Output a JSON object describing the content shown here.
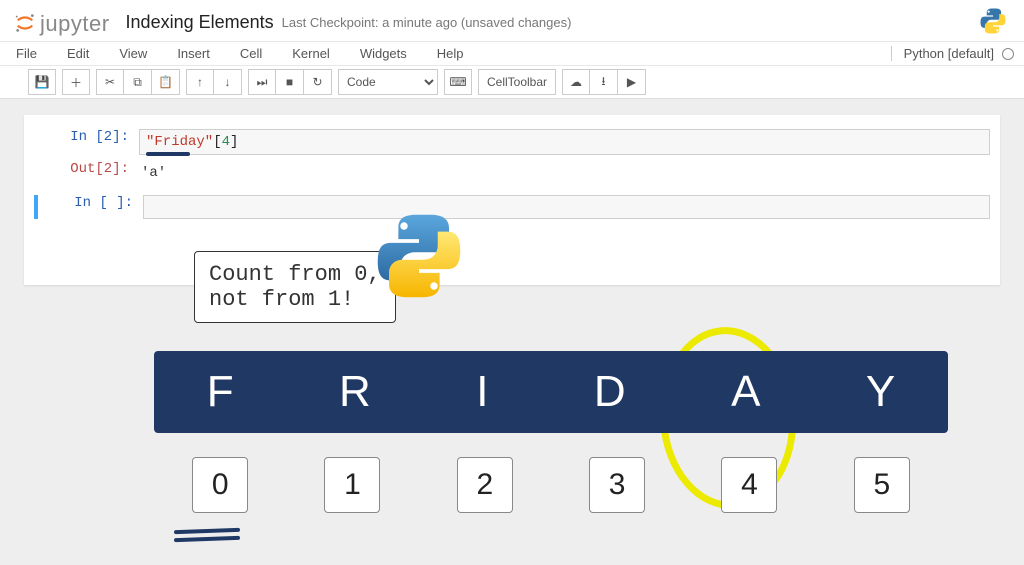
{
  "header": {
    "logo_text": "jupyter",
    "notebook_title": "Indexing Elements",
    "checkpoint": "Last Checkpoint: a minute ago (unsaved changes)"
  },
  "menubar": {
    "items": [
      "File",
      "Edit",
      "View",
      "Insert",
      "Cell",
      "Kernel",
      "Widgets",
      "Help"
    ],
    "kernel_label": "Python [default]"
  },
  "toolbar": {
    "celltype": "Code",
    "cell_toolbar_label": "CellToolbar"
  },
  "cells": {
    "in2_prompt": "In [2]:",
    "in2_code_string": "\"Friday\"",
    "in2_code_open": "[",
    "in2_code_idx": "4",
    "in2_code_close": "]",
    "out2_prompt": "Out[2]:",
    "out2_value": "'a'",
    "in_blank_prompt": "In [ ]:"
  },
  "tip": {
    "line1": "Count from 0,",
    "line2": "not from 1!"
  },
  "diagram": {
    "letters": [
      "F",
      "R",
      "I",
      "D",
      "A",
      "Y"
    ],
    "indices": [
      "0",
      "1",
      "2",
      "3",
      "4",
      "5"
    ]
  }
}
